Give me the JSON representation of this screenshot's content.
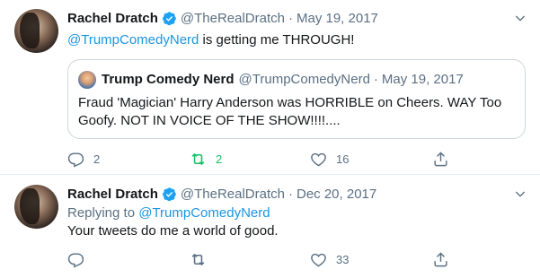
{
  "tweets": [
    {
      "author_name": "Rachel Dratch",
      "handle": "@TheRealDratch",
      "separator": "·",
      "date": "May 19, 2017",
      "mention": "@TrumpComedyNerd",
      "text_after_mention": " is getting me THROUGH!",
      "quote": {
        "author_name": "Trump Comedy Nerd",
        "handle": "@TrumpComedyNerd",
        "separator": "·",
        "date": "May 19, 2017",
        "text": "Fraud 'Magician' Harry Anderson was HORRIBLE on Cheers. WAY Too Goofy. NOT IN VOICE OF THE SHOW!!!!...."
      },
      "actions": {
        "replies": "2",
        "retweets": "2",
        "likes": "16"
      }
    },
    {
      "author_name": "Rachel Dratch",
      "handle": "@TheRealDratch",
      "separator": "·",
      "date": "Dec 20, 2017",
      "replying_to_label": "Replying to ",
      "replying_to_handle": "@TrumpComedyNerd",
      "text": "Your tweets do me a world of good.",
      "actions": {
        "replies": "",
        "retweets": "",
        "likes": "33"
      }
    }
  ],
  "colors": {
    "accent": "#1b95e0",
    "retweet_active": "#17bf63",
    "secondary_text": "#5b7083",
    "border": "#e6ecf0"
  },
  "icons": [
    "verified-badge-icon",
    "chevron-down-icon",
    "reply-icon",
    "retweet-icon",
    "like-icon",
    "share-icon"
  ]
}
